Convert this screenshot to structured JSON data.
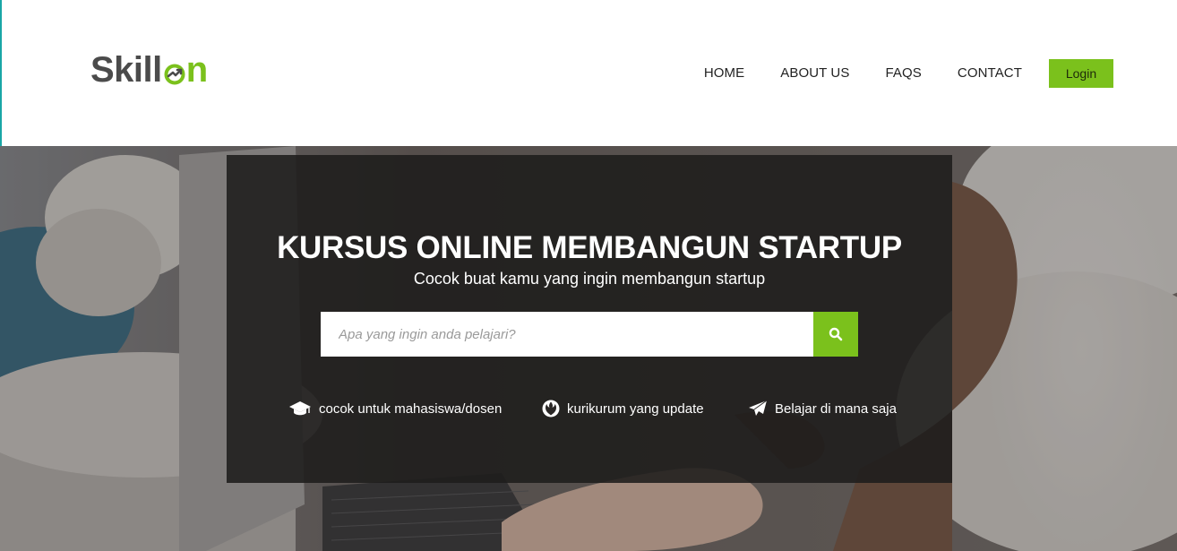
{
  "brand": {
    "logo_prefix": "Skill",
    "logo_suffix": "n",
    "color_dark": "#4b4b4b",
    "color_accent": "#7bc11c"
  },
  "nav": {
    "items": [
      {
        "label": "HOME"
      },
      {
        "label": "ABOUT US"
      },
      {
        "label": "FAQS"
      },
      {
        "label": "CONTACT"
      }
    ],
    "login_label": "Login"
  },
  "hero": {
    "title": "KURSUS ONLINE MEMBANGUN STARTUP",
    "subtitle": "Cocok buat kamu yang ingin membangun startup",
    "search": {
      "placeholder": "Apa yang ingin anda pelajari?",
      "value": "",
      "button_icon": "search-icon"
    },
    "features": [
      {
        "icon": "graduation-cap-icon",
        "label": "cocok untuk mahasiswa/dosen"
      },
      {
        "icon": "rebel-alliance-icon",
        "label": "kurikurum yang update"
      },
      {
        "icon": "paper-plane-icon",
        "label": "Belajar di mana saja"
      }
    ]
  }
}
